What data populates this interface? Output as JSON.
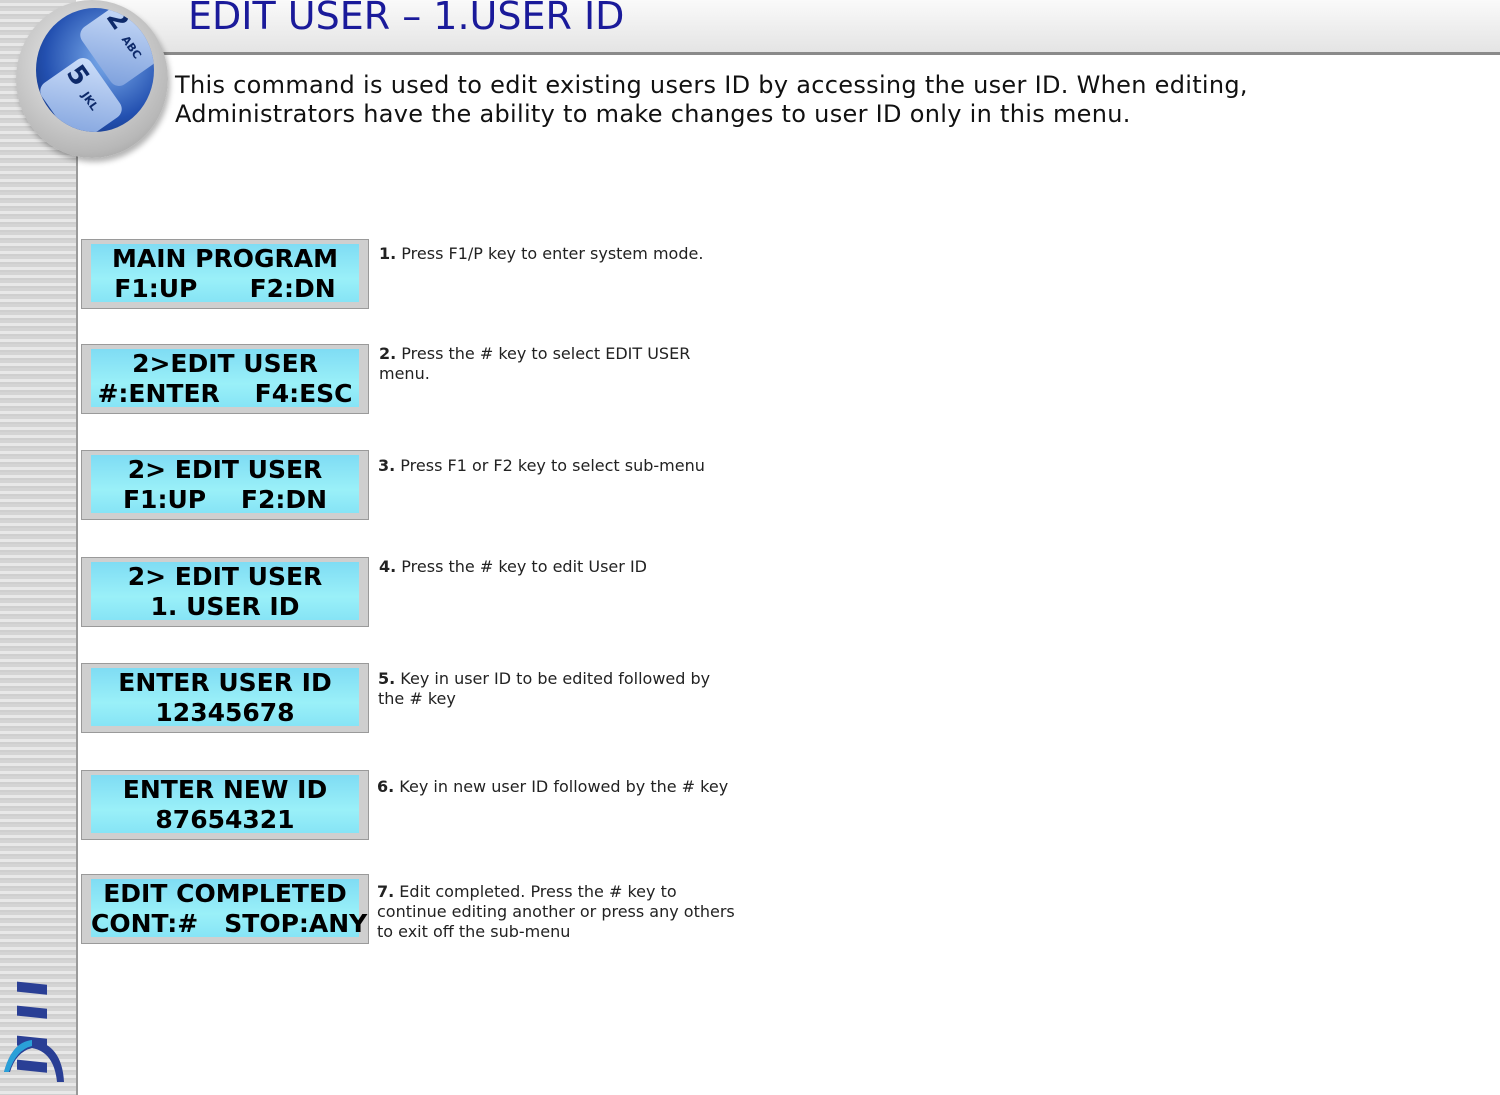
{
  "header": {
    "title": "EDIT USER – 1.USER ID"
  },
  "intro": "This command is used to edit existing users ID by accessing the user ID. When editing, Administrators have the ability to make changes to user ID only in this menu.",
  "badge": {
    "key1": "2",
    "key1_letters": "ABC",
    "key2": "5",
    "key2_letters": "JKL"
  },
  "logo": {
    "text": "IDTI",
    "color": "#2a3f95"
  },
  "colors": {
    "title": "#1a1a9a",
    "lcd": "#8ee8f6"
  },
  "steps": [
    {
      "lcd": "MAIN PROGRAM\nF1:UP      F2:DN",
      "num": "1.",
      "text": " Press F1/P key to enter system mode."
    },
    {
      "lcd": "2>EDIT USER\n#:ENTER    F4:ESC",
      "num": "2.",
      "text": " Press the # key to select EDIT USER menu."
    },
    {
      "lcd": "2> EDIT USER\nF1:UP    F2:DN",
      "num": "3.",
      "text": " Press F1 or F2  key to select sub-menu"
    },
    {
      "lcd": "2> EDIT USER\n1. USER ID",
      "num": "4.",
      "text": " Press the # key to edit User ID"
    },
    {
      "lcd": "ENTER USER ID\n12345678",
      "num": "5.",
      "text": " Key in user ID to be edited followed by the # key"
    },
    {
      "lcd": "ENTER NEW ID\n87654321",
      "num": "6.",
      "text": " Key in new user ID followed by the # key"
    },
    {
      "lcd": "EDIT COMPLETED\nCONT:#   STOP:ANY",
      "num": "7.",
      "text": " Edit completed. Press the # key to continue editing another or press any others to exit off the sub-menu"
    }
  ]
}
